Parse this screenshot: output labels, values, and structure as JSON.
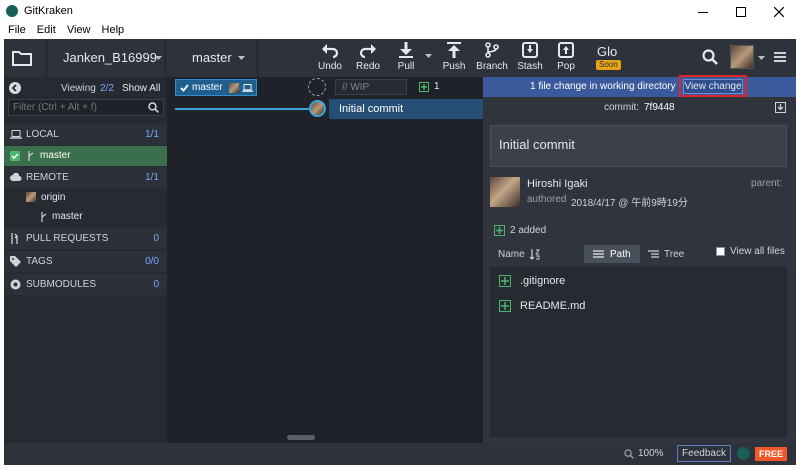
{
  "window": {
    "title": "GitKraken",
    "menu": [
      "File",
      "Edit",
      "View",
      "Help"
    ]
  },
  "toolbar": {
    "repo": "Janken_B16999",
    "branch": "master",
    "actions": [
      {
        "label": "Undo",
        "icon": "undo-icon"
      },
      {
        "label": "Redo",
        "icon": "redo-icon"
      },
      {
        "label": "Pull",
        "icon": "pull-icon"
      },
      {
        "label": "Push",
        "icon": "push-icon"
      },
      {
        "label": "Branch",
        "icon": "branch-icon"
      },
      {
        "label": "Stash",
        "icon": "stash-icon"
      },
      {
        "label": "Pop",
        "icon": "pop-icon"
      }
    ],
    "glo": {
      "label": "Glo",
      "badge": "Soon"
    }
  },
  "left_panel": {
    "viewing_label": "Viewing",
    "viewing_count": "2/2",
    "show_all": "Show All",
    "filter_placeholder": "Filter (Ctrl + Alt + f)",
    "local": {
      "title": "LOCAL",
      "count": "1/1",
      "branch": "master"
    },
    "remote": {
      "title": "REMOTE",
      "count": "1/1",
      "remote_name": "origin",
      "branch": "master"
    },
    "pull_requests": {
      "title": "PULL REQUESTS",
      "count": "0"
    },
    "tags": {
      "title": "TAGS",
      "count": "0/0"
    },
    "submodules": {
      "title": "SUBMODULES",
      "count": "0"
    }
  },
  "graph": {
    "branch_tag": "master",
    "wip_placeholder": "// WIP",
    "wip_count": "1",
    "commit_message": "Initial commit"
  },
  "right_panel": {
    "change_banner": "1 file change in working directory",
    "view_change_button": "View change",
    "commit_label": "commit:",
    "commit_hash": "7f9448",
    "commit_message": "Initial commit",
    "author_name": "Hiroshi Igaki",
    "authored_label": "authored",
    "authored_date": "2018/4/17 @ 午前9時19分",
    "parent_label": "parent:",
    "added_count": "2 added",
    "name_header": "Name",
    "path_tab": "Path",
    "tree_tab": "Tree",
    "view_all_files": "View all files",
    "files": [
      ".gitignore",
      "README.md"
    ]
  },
  "status_bar": {
    "zoom": "100%",
    "feedback": "Feedback",
    "free_badge": "FREE"
  },
  "colors": {
    "accent_green": "#4cb56e",
    "selection_blue": "#1f5f8f",
    "highlight_red": "#e0242c",
    "banner_blue": "#3a5a9c",
    "free_orange": "#f0582a"
  }
}
